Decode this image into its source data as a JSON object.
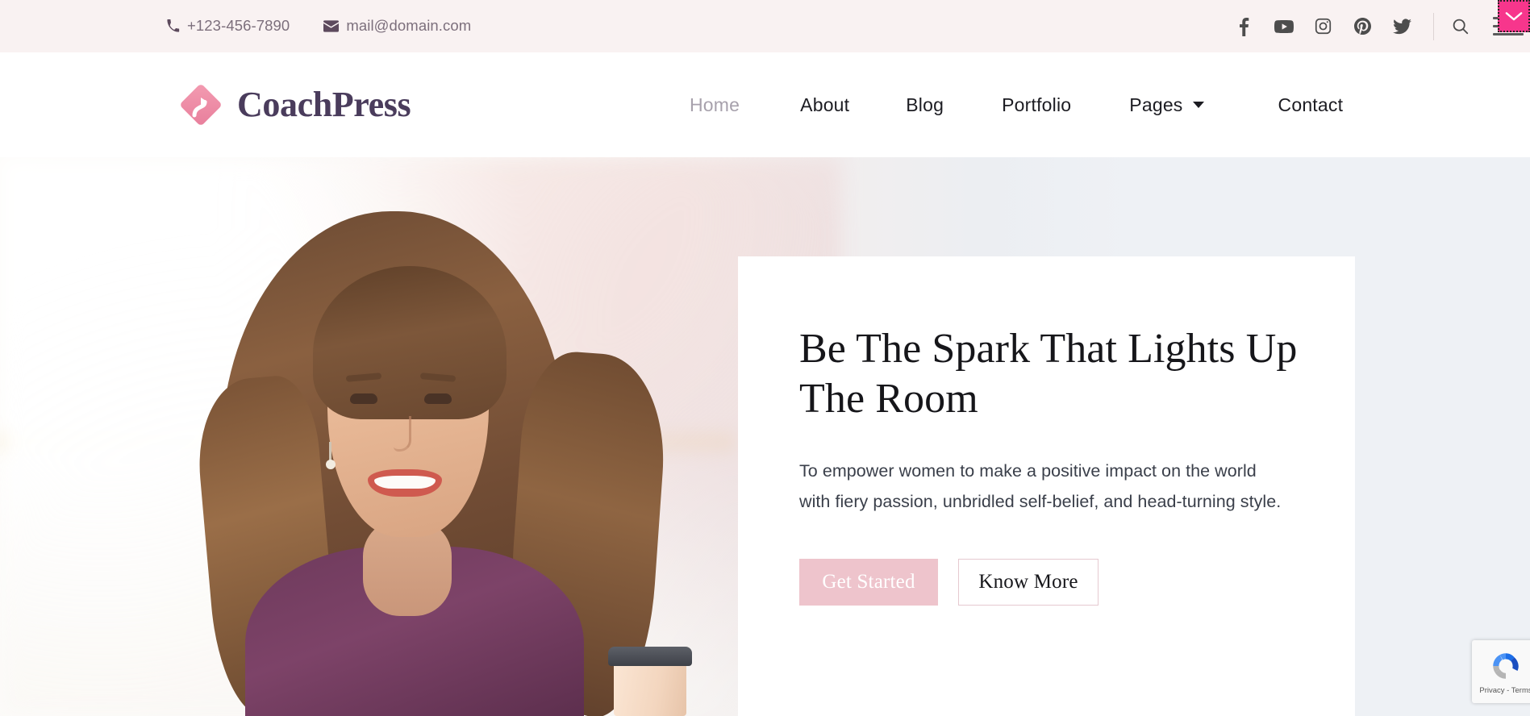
{
  "topbar": {
    "phone": "+123-456-7890",
    "email": "mail@domain.com",
    "phone_icon": "phone-icon",
    "email_icon": "envelope-icon",
    "socials": [
      {
        "name": "facebook",
        "label": "Facebook"
      },
      {
        "name": "youtube",
        "label": "YouTube"
      },
      {
        "name": "instagram",
        "label": "Instagram"
      },
      {
        "name": "pinterest",
        "label": "Pinterest"
      },
      {
        "name": "twitter",
        "label": "Twitter"
      }
    ],
    "search_icon": "search-icon",
    "menu_icon": "hamburger-menu-icon",
    "corner_toggle_icon": "chevron-down-icon",
    "corner_toggle_color": "#f7368c",
    "background_color": "#f9f2f2"
  },
  "header": {
    "logo_text": "CoachPress",
    "logo_mark": "diamond-arrow-logo",
    "logo_mark_color": "#ef8fa7",
    "nav": [
      {
        "label": "Home",
        "active": true,
        "has_dropdown": false
      },
      {
        "label": "About",
        "active": false,
        "has_dropdown": false
      },
      {
        "label": "Blog",
        "active": false,
        "has_dropdown": false
      },
      {
        "label": "Portfolio",
        "active": false,
        "has_dropdown": false
      },
      {
        "label": "Pages",
        "active": false,
        "has_dropdown": true
      },
      {
        "label": "Contact",
        "active": false,
        "has_dropdown": false
      }
    ]
  },
  "hero": {
    "title": "Be The Spark That Lights Up The Room",
    "subtitle": "To empower women to make a positive impact on the world with fiery passion, unbridled self-belief, and head-turning style.",
    "primary_button": "Get Started",
    "secondary_button": "Know More",
    "background_color": "#eef1f5",
    "primary_button_color": "#eec4cc",
    "image_alt": "smiling-woman-holding-coffee-cup"
  },
  "recaptcha": {
    "text": "Privacy - Terms",
    "logo": "recaptcha-logo"
  }
}
